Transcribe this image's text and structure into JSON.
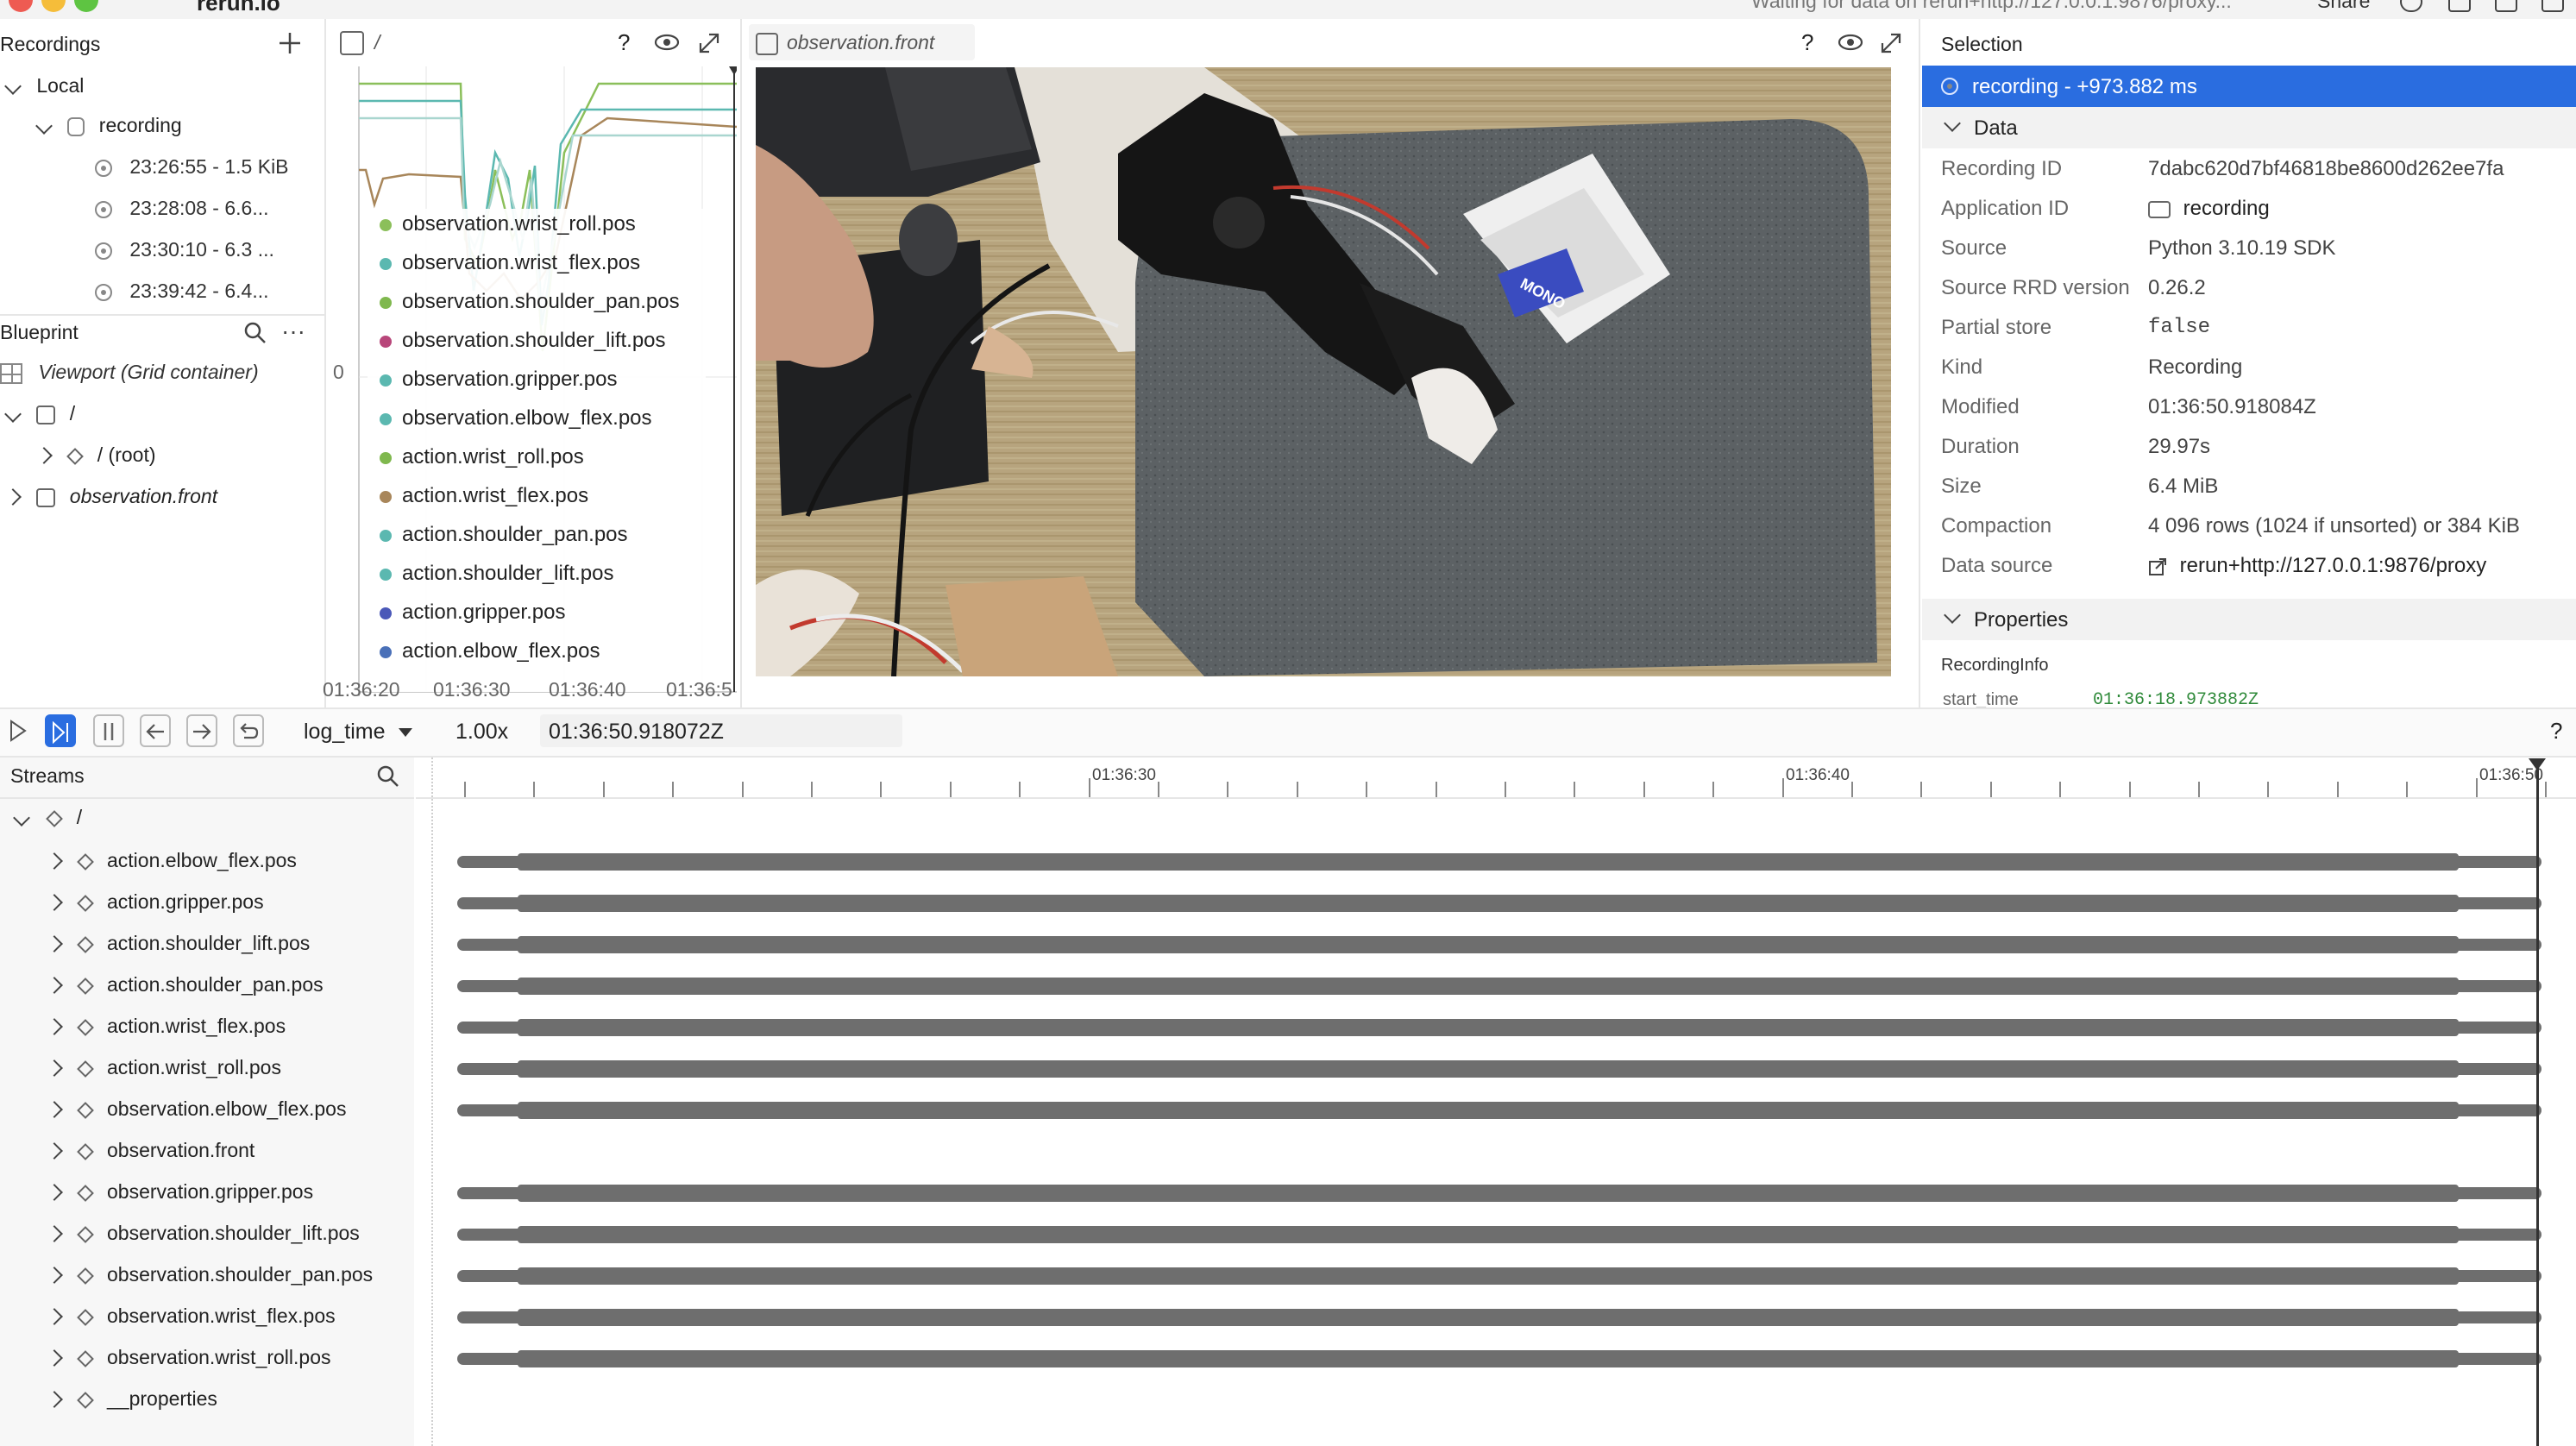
{
  "topbar": {
    "app_name": "rerun.io",
    "status": "Waiting for data on rerun+http://127.0.0.1:9876/proxy...",
    "share_label": "Share"
  },
  "recordings_panel": {
    "title": "Recordings",
    "local_label": "Local",
    "recording_label": "recording",
    "items": [
      {
        "label": "23:26:55 - 1.5 KiB"
      },
      {
        "label": "23:28:08 - 6.6..."
      },
      {
        "label": "23:30:10 - 6.3 ..."
      },
      {
        "label": "23:39:42 - 6.4..."
      }
    ]
  },
  "blueprint_panel": {
    "title": "Blueprint",
    "viewport_label": "Viewport (Grid container)",
    "root_slash": "/",
    "root_label": "/ (root)",
    "front_label": "observation.front"
  },
  "plot_view": {
    "title": "/",
    "y_zero": "0",
    "x_ticks": [
      "01:36:20",
      "01:36:30",
      "01:36:40",
      "01:36:5"
    ],
    "legend": [
      {
        "label": "observation.wrist_roll.pos",
        "color": "#8bbf5a"
      },
      {
        "label": "observation.wrist_flex.pos",
        "color": "#5bb8b0"
      },
      {
        "label": "observation.shoulder_pan.pos",
        "color": "#7fb84e"
      },
      {
        "label": "observation.shoulder_lift.pos",
        "color": "#b8467a"
      },
      {
        "label": "observation.gripper.pos",
        "color": "#5bb8b0"
      },
      {
        "label": "observation.elbow_flex.pos",
        "color": "#5bb8b0"
      },
      {
        "label": "action.wrist_roll.pos",
        "color": "#7fb84e"
      },
      {
        "label": "action.wrist_flex.pos",
        "color": "#a8865a"
      },
      {
        "label": "action.shoulder_pan.pos",
        "color": "#5bb8b0"
      },
      {
        "label": "action.shoulder_lift.pos",
        "color": "#5bb8b0"
      },
      {
        "label": "action.gripper.pos",
        "color": "#4a58b8"
      },
      {
        "label": "action.elbow_flex.pos",
        "color": "#4a70b8"
      }
    ]
  },
  "image_view": {
    "title": "observation.front"
  },
  "selection_panel": {
    "title": "Selection",
    "selected": "recording - +973.882 ms",
    "data_section": "Data",
    "fields": [
      {
        "key": "Recording ID",
        "value": "7dabc620d7bf46818be8600d262ee7fa"
      },
      {
        "key": "Application ID",
        "value": "recording"
      },
      {
        "key": "Source",
        "value": "Python 3.10.19 SDK"
      },
      {
        "key": "Source RRD version",
        "value": "0.26.2"
      },
      {
        "key": "Partial store",
        "value": "false"
      },
      {
        "key": "Kind",
        "value": "Recording"
      },
      {
        "key": "Modified",
        "value": "01:36:50.918084Z"
      },
      {
        "key": "Duration",
        "value": "29.97s"
      },
      {
        "key": "Size",
        "value": "6.4 MiB"
      },
      {
        "key": "Compaction",
        "value": "4 096 rows (1024 if unsorted) or 384 KiB"
      },
      {
        "key": "Data source",
        "value": "rerun+http://127.0.0.1:9876/proxy"
      }
    ],
    "properties_section": "Properties",
    "recording_info": "RecordingInfo",
    "start_time_key": "start_time",
    "start_time_value": "01:36:18.973882Z"
  },
  "timeline": {
    "timeline_name": "log_time",
    "speed": "1.00x",
    "current_time": "01:36:50.918072Z",
    "help": "?",
    "time_labels": [
      "01:36:30",
      "01:36:40",
      "01:36:50"
    ]
  },
  "streams": {
    "title": "Streams",
    "root": "/",
    "items": [
      {
        "label": "action.elbow_flex.pos"
      },
      {
        "label": "action.gripper.pos"
      },
      {
        "label": "action.shoulder_lift.pos"
      },
      {
        "label": "action.shoulder_pan.pos"
      },
      {
        "label": "action.wrist_flex.pos"
      },
      {
        "label": "action.wrist_roll.pos"
      },
      {
        "label": "observation.elbow_flex.pos"
      },
      {
        "label": "observation.front"
      },
      {
        "label": "observation.gripper.pos"
      },
      {
        "label": "observation.shoulder_lift.pos"
      },
      {
        "label": "observation.shoulder_pan.pos"
      },
      {
        "label": "observation.wrist_flex.pos"
      },
      {
        "label": "observation.wrist_roll.pos"
      },
      {
        "label": "__properties"
      }
    ]
  },
  "product_label": "MONO"
}
